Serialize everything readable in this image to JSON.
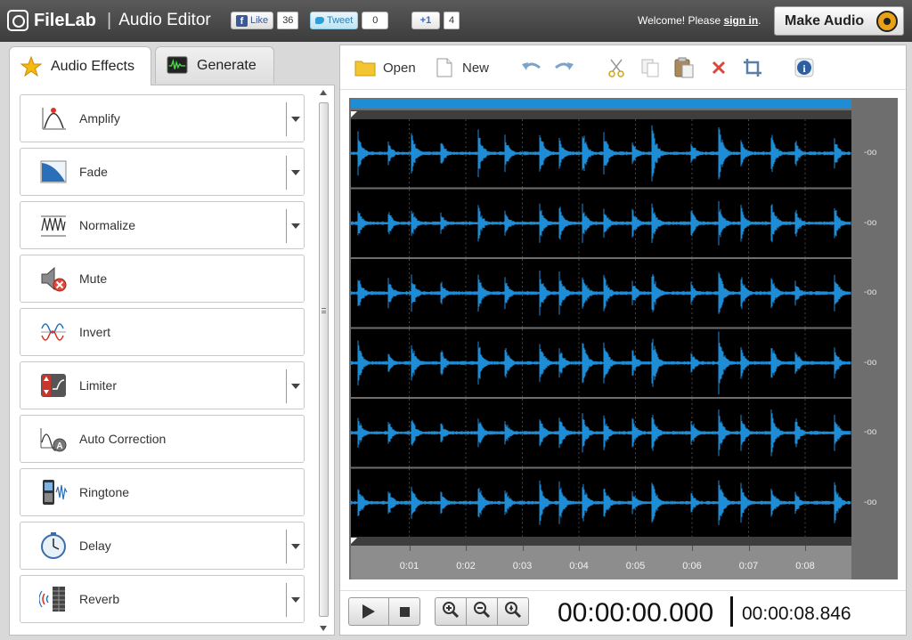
{
  "header": {
    "brand": "FileLab",
    "separator": "|",
    "app_title": "Audio Editor",
    "social": {
      "like_label": "Like",
      "like_count": "36",
      "tweet_label": "Tweet",
      "tweet_count": "0",
      "plus_label": "+1",
      "plus_count": "4"
    },
    "welcome_prefix": "Welcome! Please ",
    "sign_in": "sign in",
    "welcome_suffix": ".",
    "make_audio": "Make Audio"
  },
  "left_tabs": [
    {
      "label": "Audio Effects",
      "icon": "star-icon",
      "active": true
    },
    {
      "label": "Generate",
      "icon": "waveform-monitor-icon",
      "active": false
    }
  ],
  "effects": [
    {
      "label": "Amplify",
      "icon": "amplify-icon",
      "has_dropdown": true
    },
    {
      "label": "Fade",
      "icon": "fade-icon",
      "has_dropdown": true
    },
    {
      "label": "Normalize",
      "icon": "normalize-icon",
      "has_dropdown": true
    },
    {
      "label": "Mute",
      "icon": "mute-icon",
      "has_dropdown": false
    },
    {
      "label": "Invert",
      "icon": "invert-icon",
      "has_dropdown": false
    },
    {
      "label": "Limiter",
      "icon": "limiter-icon",
      "has_dropdown": true
    },
    {
      "label": "Auto Correction",
      "icon": "auto-correction-icon",
      "has_dropdown": false
    },
    {
      "label": "Ringtone",
      "icon": "ringtone-icon",
      "has_dropdown": false
    },
    {
      "label": "Delay",
      "icon": "delay-icon",
      "has_dropdown": true
    },
    {
      "label": "Reverb",
      "icon": "reverb-icon",
      "has_dropdown": true
    }
  ],
  "toolbar": {
    "open_label": "Open",
    "new_label": "New",
    "icons": [
      "undo-icon",
      "redo-icon",
      "cut-icon",
      "copy-icon",
      "paste-icon",
      "delete-icon",
      "crop-icon",
      "info-icon"
    ]
  },
  "waveform": {
    "channel_count": 6,
    "db_labels": [
      "-oo",
      "-oo",
      "-oo",
      "-oo",
      "-oo",
      "-oo"
    ],
    "time_ticks": [
      "0:01",
      "0:02",
      "0:03",
      "0:04",
      "0:05",
      "0:06",
      "0:07",
      "0:08"
    ],
    "wave_color": "#1f8cd6",
    "selection_color": "#1f8cd6"
  },
  "transport": {
    "current_time": "00:00:00.000",
    "total_time": "00:00:08.846",
    "buttons": [
      "play-icon",
      "stop-icon",
      "zoom-in-icon",
      "zoom-out-icon",
      "zoom-fit-icon"
    ]
  }
}
